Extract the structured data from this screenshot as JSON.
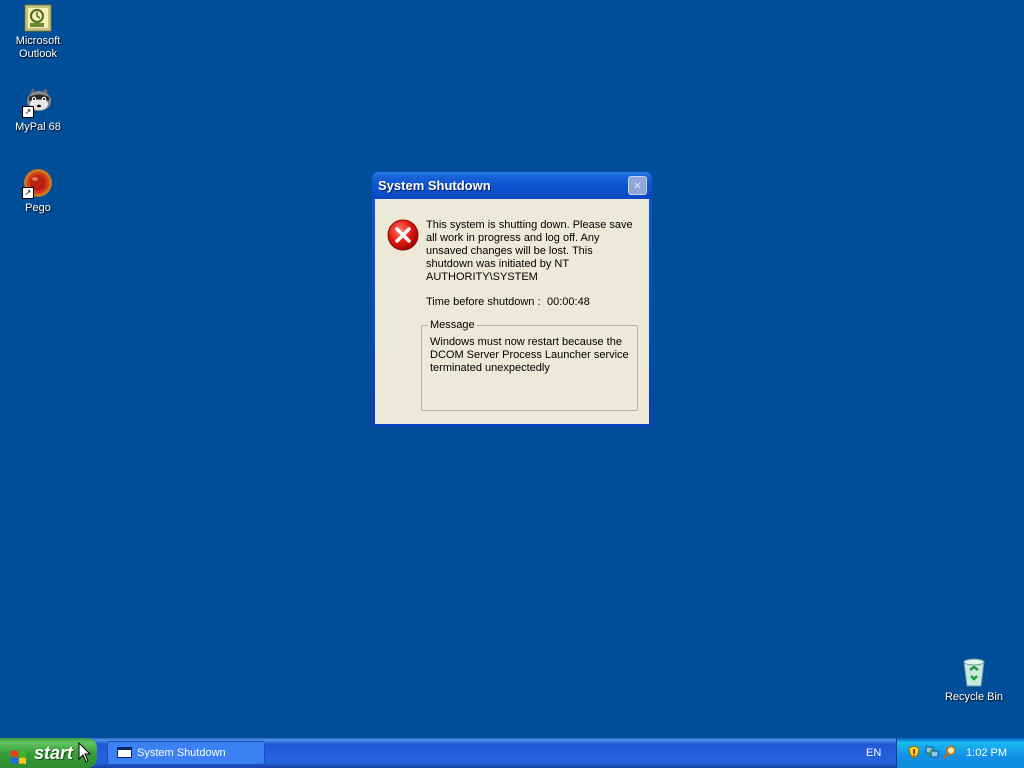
{
  "desktop": {
    "background": "#004e98",
    "icons": [
      {
        "label_line1": "Microsoft",
        "label_line2": "Outlook",
        "icon": "outlook-icon"
      },
      {
        "label": "MyPal 68",
        "icon": "mypal-raccoon-icon"
      },
      {
        "label": "Pego",
        "icon": "pego-icon"
      },
      {
        "label": "Recycle Bin",
        "icon": "recycle-bin-icon"
      }
    ]
  },
  "dialog": {
    "title": "System Shutdown",
    "close_label": "×",
    "main_text": "This system is shutting down. Please save all work in progress and log off. Any unsaved changes will be lost. This shutdown was initiated by NT AUTHORITY\\SYSTEM",
    "time_label": "Time before shutdown :",
    "time_value": "00:00:48",
    "message_label": "Message",
    "message_text": "Windows must now restart because the DCOM Server Process Launcher service terminated unexpectedly"
  },
  "taskbar": {
    "start_label": "start",
    "task_item_label": "System Shutdown",
    "language": "EN",
    "clock": "1:02 PM",
    "tray_icons": [
      "security-shield-icon",
      "network-icon",
      "search-magnifier-icon"
    ]
  }
}
